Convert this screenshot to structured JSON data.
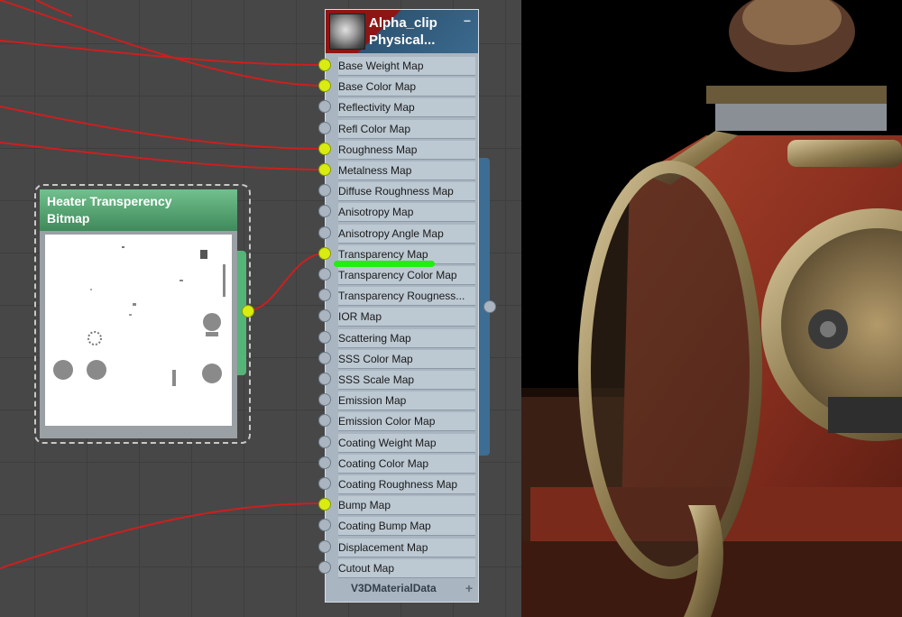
{
  "material_node": {
    "title_line1": "Alpha_clip",
    "title_line2": "Physical...",
    "collapse_symbol": "−",
    "footer_label": "V3DMaterialData",
    "add_symbol": "+",
    "slots": [
      {
        "label": "Base Weight Map",
        "connected": true
      },
      {
        "label": "Base Color Map",
        "connected": true
      },
      {
        "label": "Reflectivity Map",
        "connected": false
      },
      {
        "label": "Refl Color Map",
        "connected": false
      },
      {
        "label": "Roughness Map",
        "connected": true
      },
      {
        "label": "Metalness Map",
        "connected": true
      },
      {
        "label": "Diffuse Roughness Map",
        "connected": false
      },
      {
        "label": "Anisotropy Map",
        "connected": false
      },
      {
        "label": "Anisotropy Angle Map",
        "connected": false
      },
      {
        "label": "Transparency Map",
        "connected": true
      },
      {
        "label": "Transparency Color Map",
        "connected": false
      },
      {
        "label": "Transparency  Rougness...",
        "connected": false
      },
      {
        "label": "IOR Map",
        "connected": false
      },
      {
        "label": "Scattering Map",
        "connected": false
      },
      {
        "label": "SSS Color Map",
        "connected": false
      },
      {
        "label": "SSS Scale Map",
        "connected": false
      },
      {
        "label": "Emission Map",
        "connected": false
      },
      {
        "label": "Emission Color Map",
        "connected": false
      },
      {
        "label": "Coating Weight Map",
        "connected": false
      },
      {
        "label": "Coating Color Map",
        "connected": false
      },
      {
        "label": "Coating Roughness Map",
        "connected": false
      },
      {
        "label": "Bump Map",
        "connected": true
      },
      {
        "label": "Coating Bump Map",
        "connected": false
      },
      {
        "label": "Displacement Map",
        "connected": false
      },
      {
        "label": "Cutout Map",
        "connected": false
      }
    ]
  },
  "bitmap_node": {
    "title_line1": "Heater Transperency",
    "title_line2": "Bitmap"
  },
  "colors": {
    "wire": "#cc1f1f",
    "pin_connected": "#d8ec12",
    "highlight": "#22ee10",
    "material_header_red": "#8e1515",
    "material_header_blue": "#3b6a8e",
    "bitmap_header": "#4f9e6c"
  },
  "icons": {
    "material_thumbnail": "sphere-thumbnail-icon",
    "collapse": "minus-icon",
    "add": "plus-icon"
  }
}
